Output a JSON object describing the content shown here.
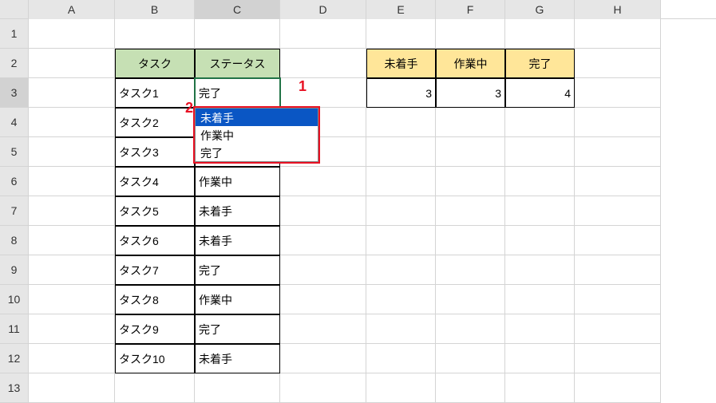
{
  "columns": [
    "A",
    "B",
    "C",
    "D",
    "E",
    "F",
    "G",
    "H"
  ],
  "rows": [
    "1",
    "2",
    "3",
    "4",
    "5",
    "6",
    "7",
    "8",
    "9",
    "10",
    "11",
    "12",
    "13"
  ],
  "headers": {
    "B2": "タスク",
    "C2": "ステータス",
    "E2": "未着手",
    "F2": "作業中",
    "G2": "完了"
  },
  "tasks": {
    "B3": "タスク1",
    "C3": "完了",
    "B4": "タスク2",
    "C4": "",
    "B5": "タスク3",
    "C5": "",
    "B6": "タスク4",
    "C6": "作業中",
    "B7": "タスク5",
    "C7": "未着手",
    "B8": "タスク6",
    "C8": "未着手",
    "B9": "タスク7",
    "C9": "完了",
    "B10": "タスク8",
    "C10": "作業中",
    "B11": "タスク9",
    "C11": "完了",
    "B12": "タスク10",
    "C12": "未着手"
  },
  "summary": {
    "E3": "3",
    "F3": "3",
    "G3": "4"
  },
  "dropdown": {
    "options": [
      "未着手",
      "作業中",
      "完了"
    ],
    "selected_index": 0
  },
  "annotations": {
    "one": "1",
    "two": "2"
  },
  "active_cell": "C3",
  "selected_col": "C",
  "selected_row": "3"
}
